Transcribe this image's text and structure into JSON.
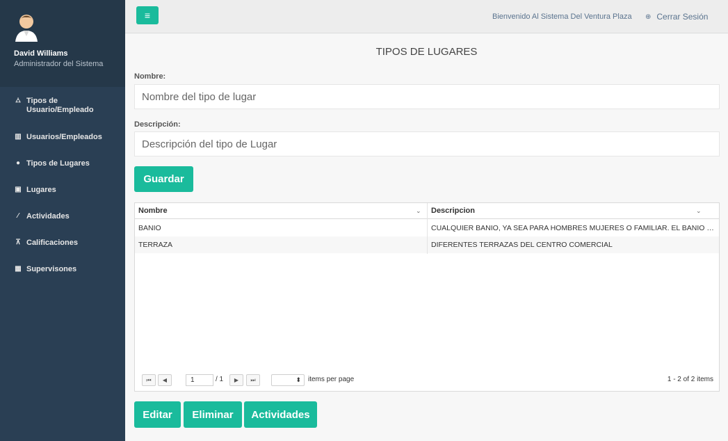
{
  "profile": {
    "name": "David Williams",
    "role": "Administrador del Sistema"
  },
  "menu": [
    {
      "icon": "sitemap-icon",
      "glyph": "⛼",
      "label_line1": "Tipos de",
      "label_line2": "Usuario/Empleado"
    },
    {
      "icon": "bar-chart-icon",
      "glyph": "▥",
      "label_line1": "Usuarios/Empleados"
    },
    {
      "icon": "globe-icon",
      "glyph": "●",
      "label_line1": "Tipos de Lugares"
    },
    {
      "icon": "picture-icon",
      "glyph": "▣",
      "label_line1": "Lugares"
    },
    {
      "icon": "magic-wand-icon",
      "glyph": "⁄",
      "label_line1": "Actividades"
    },
    {
      "icon": "flask-icon",
      "glyph": "⊼",
      "label_line1": "Calificaciones"
    },
    {
      "icon": "table-icon",
      "glyph": "▦",
      "label_line1": "Supervisones"
    }
  ],
  "topbar": {
    "toggle_glyph": "≡",
    "welcome": "Bienvenido Al Sistema Del Ventura Plaza",
    "logout_icon": "⊕",
    "logout": "Cerrar Sesión"
  },
  "form": {
    "title": "TIPOS DE LUGARES",
    "name_label": "Nombre:",
    "name_placeholder": "Nombre del tipo de lugar",
    "desc_label": "Descripción:",
    "desc_placeholder": "Descripción del tipo de Lugar",
    "save_label": "Guardar"
  },
  "grid": {
    "columns": [
      "Nombre",
      "Descripcion"
    ],
    "rows": [
      [
        "BANIO",
        "CUALQUIER BANIO, YA SEA PARA HOMBRES MUJERES O FAMILIAR. EL BANIO PUEDE ESTAR EN CUALQUIER PISO"
      ],
      [
        "TERRAZA",
        "DIFERENTES TERRAZAS DEL CENTRO COMERCIAL"
      ]
    ],
    "pager": {
      "first": "⏮",
      "prev": "◀",
      "next": "▶",
      "last": "⏭",
      "current_page": "1",
      "of_pages": "/ 1",
      "page_size_value": "",
      "page_size_arrow": "⬍",
      "items_per_page": "items per page",
      "info": "1 - 2 of 2 items"
    }
  },
  "actions": {
    "edit": "Editar",
    "delete": "Eliminar",
    "activities": "Actividades"
  },
  "colors": {
    "accent": "#1abb9c",
    "sidebar": "#2a3f54"
  }
}
